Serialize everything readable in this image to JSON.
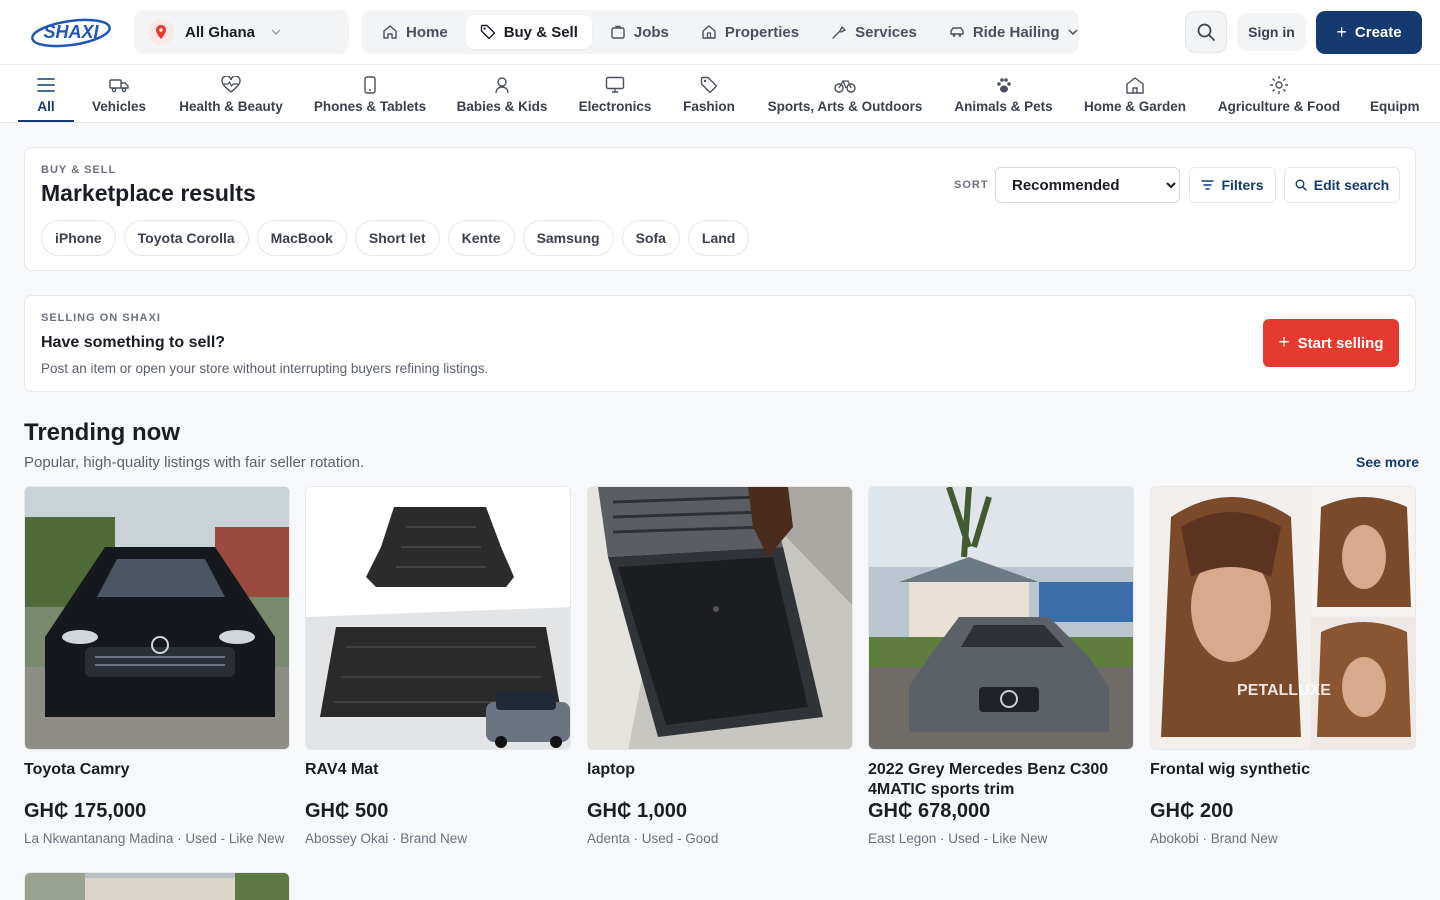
{
  "header": {
    "location_label": "All Ghana",
    "nav_tabs": [
      {
        "label": "Home",
        "icon": "home-icon"
      },
      {
        "label": "Buy & Sell",
        "icon": "tag-icon"
      },
      {
        "label": "Jobs",
        "icon": "briefcase-icon"
      },
      {
        "label": "Properties",
        "icon": "building-icon"
      },
      {
        "label": "Services",
        "icon": "tools-icon"
      },
      {
        "label": "Ride Hailing",
        "icon": "car-icon"
      }
    ],
    "active_tab": "Buy & Sell",
    "signin_label": "Sign in",
    "create_label": "Create"
  },
  "categories": [
    {
      "label": "All",
      "icon": "menu-icon",
      "active": true
    },
    {
      "label": "Vehicles",
      "icon": "truck-icon"
    },
    {
      "label": "Health & Beauty",
      "icon": "heart-pulse-icon"
    },
    {
      "label": "Phones & Tablets",
      "icon": "phone-icon"
    },
    {
      "label": "Babies & Kids",
      "icon": "person-icon"
    },
    {
      "label": "Electronics",
      "icon": "monitor-icon"
    },
    {
      "label": "Fashion",
      "icon": "tag-icon"
    },
    {
      "label": "Sports, Arts & Outdoors",
      "icon": "bicycle-icon"
    },
    {
      "label": "Animals & Pets",
      "icon": "paw-icon"
    },
    {
      "label": "Home & Garden",
      "icon": "house-icon"
    },
    {
      "label": "Agriculture & Food",
      "icon": "sun-icon"
    },
    {
      "label": "Equipm",
      "icon": ""
    }
  ],
  "results": {
    "eyebrow": "BUY & SELL",
    "title": "Marketplace results",
    "sort_label": "SORT",
    "sort_value": "Recommended",
    "filters_label": "Filters",
    "edit_search_label": "Edit search",
    "chips": [
      "iPhone",
      "Toyota Corolla",
      "MacBook",
      "Short let",
      "Kente",
      "Samsung",
      "Sofa",
      "Land"
    ]
  },
  "sell_banner": {
    "eyebrow": "SELLING ON SHAXI",
    "title": "Have something to sell?",
    "description": "Post an item or open your store without interrupting buyers refining listings.",
    "button_label": "Start selling"
  },
  "trending": {
    "title": "Trending now",
    "subtitle": "Popular, high-quality listings with fair seller rotation.",
    "see_more_label": "See more",
    "listings": [
      {
        "title": "Toyota Camry",
        "price": "GH₵ 175,000",
        "meta": "La Nkwantanang Madina · Used - Like New"
      },
      {
        "title": "RAV4 Mat",
        "price": "GH₵ 500",
        "meta": "Abossey Okai · Brand New"
      },
      {
        "title": "laptop",
        "price": "GH₵ 1,000",
        "meta": "Adenta · Used - Good"
      },
      {
        "title": "2022 Grey Mercedes Benz C300 4MATIC sports trim",
        "price": "GH₵ 678,000",
        "meta": "East Legon · Used - Like New"
      },
      {
        "title": "Frontal wig synthetic",
        "price": "GH₵ 200",
        "meta": "Abokobi · Brand New"
      }
    ]
  },
  "colors": {
    "brand_navy": "#143a70",
    "accent_red": "#e63a30"
  }
}
